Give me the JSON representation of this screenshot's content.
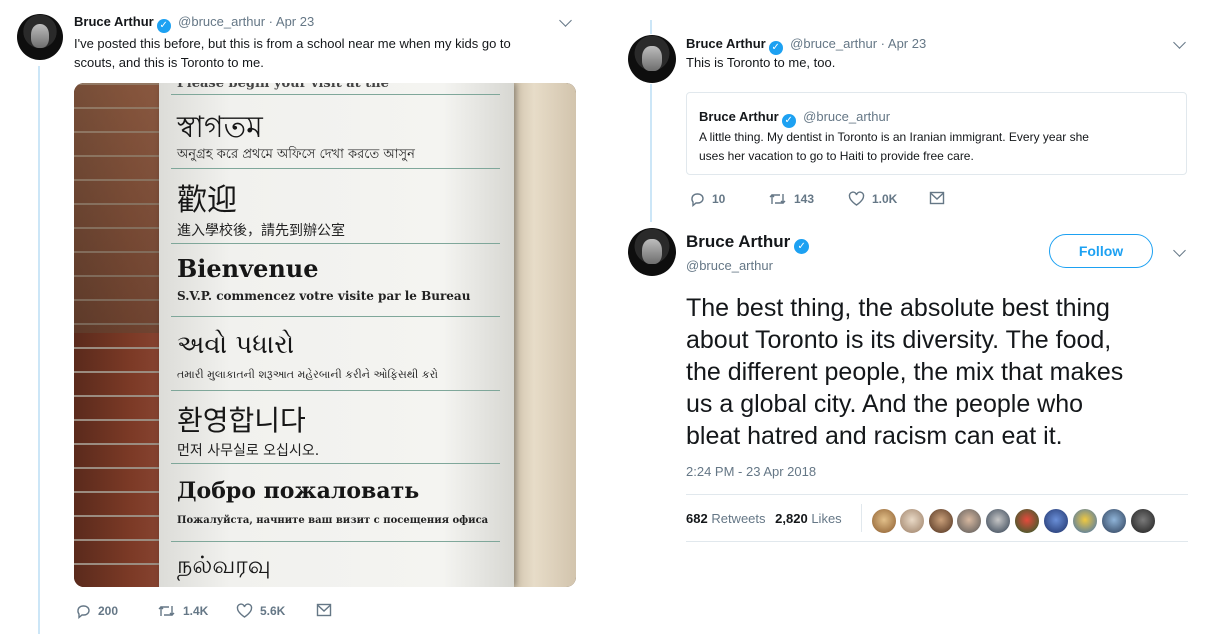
{
  "left_tweet": {
    "name": "Bruce Arthur",
    "handle_date": "@bruce_arthur · Apr 23",
    "text_line1": "I've posted this before, but this is from a school near me when my kids go to",
    "text_line2": "scouts, and this is Toronto to me.",
    "photo_sign": {
      "partial_top": "Please begin your visit at the",
      "bengali_big": "স্বাগতম",
      "bengali_small": "অনুগ্রহ করে প্রথমে অফিসে দেখা করতে আসুন",
      "chinese_big": "歡迎",
      "chinese_small": "進入學校後，請先到辦公室",
      "french_big": "Bienvenue",
      "french_small": "S.V.P. commencez votre visite par le Bureau",
      "gujarati_big": "અવો પધારો",
      "gujarati_small": "તમારી મુલાકાતની શરૂઆત મહેરબાની કરીને ઓફિસથી કરો",
      "korean_big": "환영합니다",
      "korean_small": "먼저 사무실로 오십시오.",
      "russian_big": "Добро пожаловать",
      "russian_small": "Пожалуйста, начните ваш визит с посещения офиса",
      "tamil_big": "நல்வரவு"
    },
    "replies": "200",
    "retweets": "1.4K",
    "likes": "5.6K"
  },
  "right_tweet_top": {
    "name": "Bruce Arthur",
    "handle_date": "@bruce_arthur · Apr 23",
    "text": "This is Toronto to me, too.",
    "quote": {
      "name": "Bruce Arthur",
      "handle": "@bruce_arthur",
      "text_line1": "A little thing. My dentist in Toronto is an Iranian immigrant. Every year she",
      "text_line2": "uses her vacation to go to Haiti to provide free care."
    },
    "replies": "10",
    "retweets": "143",
    "likes": "1.0K"
  },
  "main_tweet": {
    "name": "Bruce Arthur",
    "handle": "@bruce_arthur",
    "follow_label": "Follow",
    "lines": [
      "The best thing, the absolute best thing",
      "about Toronto is its diversity. The food,",
      "the different people, the mix that makes",
      "us a global city. And the people who",
      "bleat hatred and racism can eat it."
    ],
    "timestamp": "2:24 PM - 23 Apr 2018",
    "retweets_count": "682",
    "retweets_label": "Retweets",
    "likes_count": "2,820",
    "likes_label": "Likes"
  },
  "colors": {
    "accent": "#1da1f2",
    "muted": "#657786",
    "thread_line": "#cce6f7",
    "border": "#e1e8ed"
  }
}
